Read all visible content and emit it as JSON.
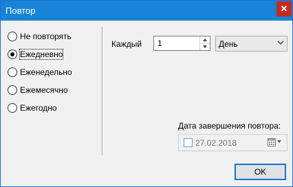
{
  "window": {
    "title": "Повтор",
    "close_glyph": "✕"
  },
  "frequency": {
    "options": [
      {
        "label": "Не повторять",
        "checked": false
      },
      {
        "label": "Ежедневно",
        "checked": true
      },
      {
        "label": "Еженедельно",
        "checked": false
      },
      {
        "label": "Ежемесячно",
        "checked": false
      },
      {
        "label": "Ежегодно",
        "checked": false
      }
    ]
  },
  "interval": {
    "label": "Каждый",
    "value": "1",
    "unit_selected": "День"
  },
  "end_date": {
    "label": "Дата завершения повтора:",
    "value": "27.02.2018",
    "checked": false
  },
  "buttons": {
    "ok_label": "OK"
  },
  "icons": {
    "close": "close-icon",
    "spin_up": "spin-up-icon",
    "spin_down": "spin-down-icon",
    "dropdown": "chevron-down-icon",
    "calendar": "calendar-icon"
  }
}
